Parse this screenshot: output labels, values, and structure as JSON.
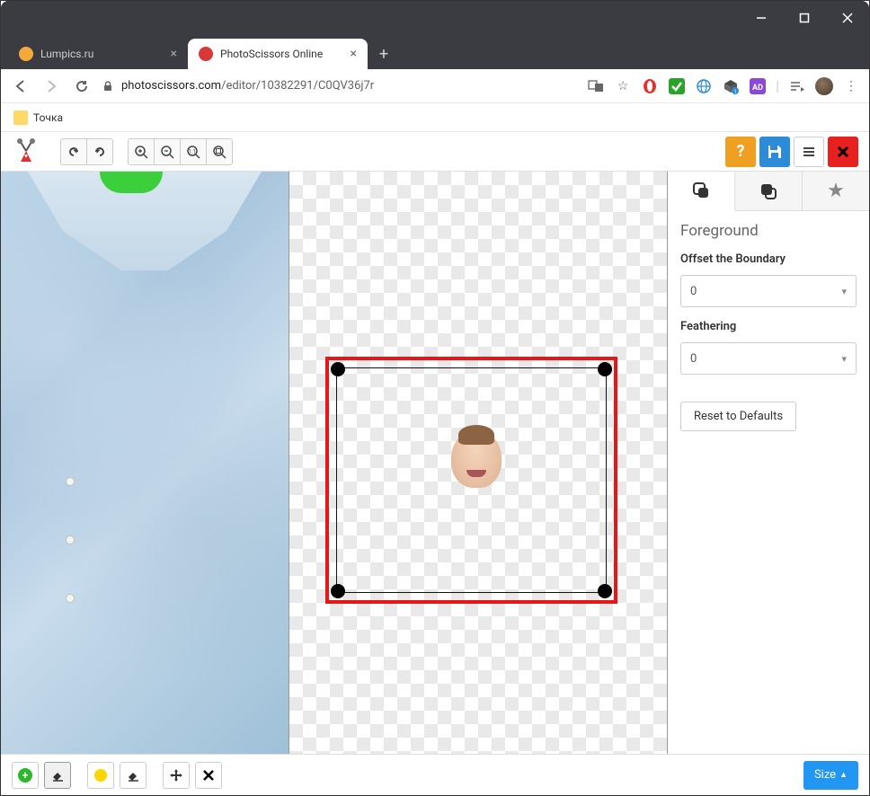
{
  "browser": {
    "tabs": [
      {
        "title": "Lumpics.ru",
        "active": false,
        "favicon": "#f4a93c"
      },
      {
        "title": "PhotoScissors Online",
        "active": true,
        "favicon": "#d93838"
      }
    ],
    "url_domain": "photoscissors.com",
    "url_path": "/editor/10382291/C0QV36j7r",
    "bookmark": "Точка"
  },
  "toolbar": {
    "help_color": "#f0a020",
    "save_color": "#2d8cd8",
    "menu_color": "#ffffff",
    "close_color": "#e82020"
  },
  "right_panel": {
    "title": "Foreground",
    "offset_label": "Offset the Boundary",
    "offset_value": "0",
    "feathering_label": "Feathering",
    "feathering_value": "0",
    "reset_label": "Reset to Defaults"
  },
  "bottom": {
    "size_label": "Size"
  }
}
